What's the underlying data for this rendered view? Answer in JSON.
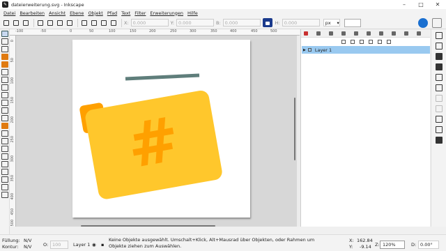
{
  "window": {
    "title": "dateierweiterung.svg - Inkscape",
    "app_icon_glyph": "✎"
  },
  "menu": [
    "Datei",
    "Bearbeiten",
    "Ansicht",
    "Ebene",
    "Objekt",
    "Pfad",
    "Text",
    "Filter",
    "Erweiterungen",
    "Hilfe"
  ],
  "toolbar": {
    "x_label": "X:",
    "x_value": "0.000",
    "y_label": "Y:",
    "y_value": "0.000",
    "b_label": "B:",
    "b_value": "0.000",
    "h_label": "H:",
    "h_value": "0.000",
    "unit": "px"
  },
  "ruler": {
    "h_ticks": [
      "-100",
      "-50",
      "0",
      "50",
      "100",
      "150",
      "200",
      "250",
      "300",
      "350",
      "400",
      "450",
      "500"
    ],
    "v_ticks": [
      "0",
      "50",
      "100",
      "150",
      "200",
      "250",
      "300",
      "350",
      "400",
      "450",
      "500"
    ]
  },
  "layers_panel": {
    "layer_name": "Layer 1"
  },
  "artwork": {
    "folder_color": "#ffc72c",
    "folder_tab_color": "#ffa000",
    "hash_color": "#ffa000",
    "bar_color": "#5f7e7b",
    "hash_glyph": "#"
  },
  "status": {
    "fill_label": "Füllung:",
    "fill_value": "N/V",
    "stroke_label": "Kontur:",
    "stroke_value": "N/V",
    "opacity_label": "O:",
    "opacity_value": "100",
    "layer": "Layer 1",
    "message": "Keine Objekte ausgewählt. Umschalt+Klick, Alt+Mausrad über Objekten, oder Rahmen um Objekte ziehen zum Auswählen.",
    "x_label": "X:",
    "x_value": "162.84",
    "y_label": "Y:",
    "y_value": "-9.14",
    "z_label": "Z:",
    "zoom": "120%",
    "d_label": "D:",
    "rotation": "0.00°"
  }
}
